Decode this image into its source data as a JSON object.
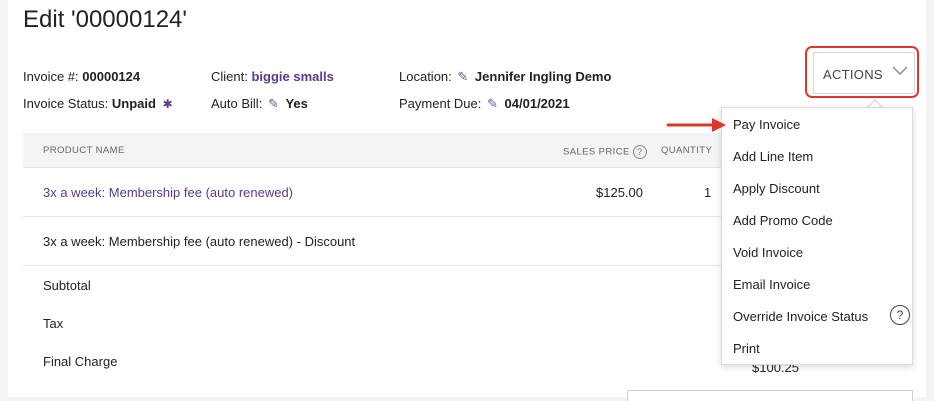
{
  "page": {
    "title": "Edit '00000124'"
  },
  "invoice": {
    "number_label": "Invoice #:",
    "number": "00000124",
    "status_label": "Invoice Status:",
    "status": "Unpaid",
    "client_label": "Client:",
    "client": "biggie smalls",
    "auto_bill_label": "Auto Bill:",
    "auto_bill": "Yes",
    "location_label": "Location:",
    "location": "Jennifer Ingling Demo",
    "payment_due_label": "Payment Due:",
    "payment_due": "04/01/2021"
  },
  "actions": {
    "label": "ACTIONS",
    "menu": [
      "Pay Invoice",
      "Add Line Item",
      "Apply Discount",
      "Add Promo Code",
      "Void Invoice",
      "Email Invoice",
      "Override Invoice Status",
      "Print"
    ]
  },
  "table": {
    "headers": {
      "product": "PRODUCT NAME",
      "sales_price": "SALES PRICE",
      "quantity": "QUANTITY"
    },
    "rows": [
      {
        "product": "3x a week: Membership fee (auto renewed)",
        "price": "$125.00",
        "qty": "1"
      },
      {
        "product": "3x a week: Membership fee (auto renewed) - Discount"
      }
    ]
  },
  "summary": {
    "subtotal": "Subtotal",
    "tax": "Tax",
    "final": "Final Charge",
    "final_value_partial": "$100.25"
  },
  "icons": [
    "pencil-icon",
    "bug-icon",
    "chevron-down-icon",
    "help-icon",
    "arrow-icon"
  ],
  "colors": {
    "accent": "#5b3b8c",
    "highlight": "#d9382b"
  }
}
